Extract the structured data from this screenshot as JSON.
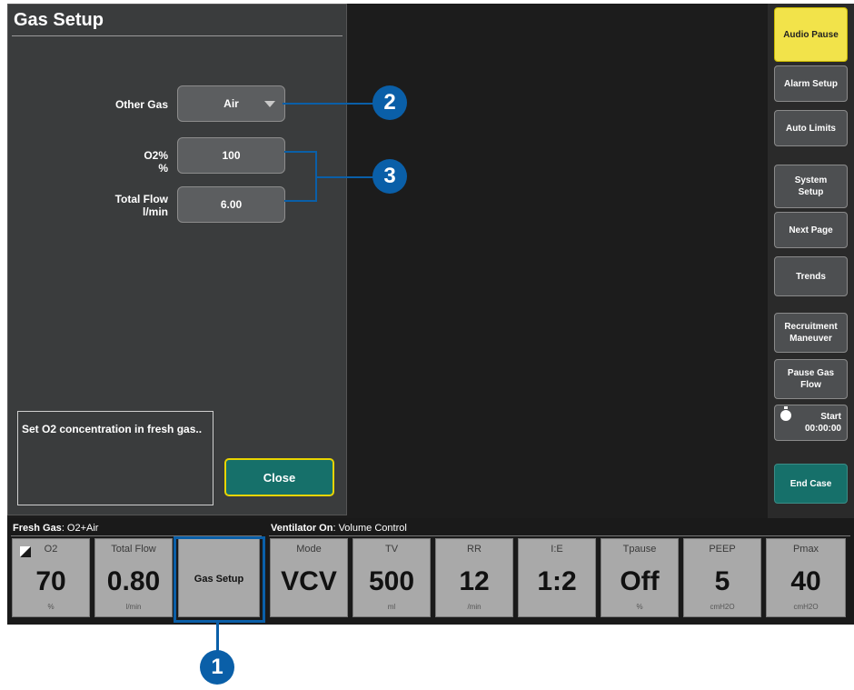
{
  "gas_setup": {
    "title": "Gas Setup",
    "other_gas_label": "Other Gas",
    "other_gas_value": "Air",
    "o2_label_line1": "O2%",
    "o2_label_line2": "%",
    "o2_value": "100",
    "total_flow_label_line1": "Total Flow",
    "total_flow_label_line2": "l/min",
    "total_flow_value": "6.00",
    "hint_text": "Set O2 concentration in fresh gas..",
    "close_label": "Close"
  },
  "side_buttons": [
    "Audio Pause",
    "Alarm Setup",
    "Auto Limits",
    "System Setup",
    "Next Page",
    "Trends",
    "Recruitment Maneuver",
    "Pause Gas Flow"
  ],
  "timer": {
    "label": "Start",
    "value": "00:00:00"
  },
  "end_case_label": "End Case",
  "fresh_gas": {
    "heading": "Fresh Gas",
    "mode": ": O2+Air",
    "o2": {
      "label": "O2",
      "value": "70",
      "unit": "%"
    },
    "total_flow": {
      "label": "Total Flow",
      "value": "0.80",
      "unit": "l/min"
    },
    "gas_setup_button": "Gas Setup"
  },
  "ventilator": {
    "heading": "Ventilator On",
    "mode_text": ": Volume Control",
    "tiles": [
      {
        "label": "Mode",
        "value": "VCV",
        "unit": ""
      },
      {
        "label": "TV",
        "value": "500",
        "unit": "ml"
      },
      {
        "label": "RR",
        "value": "12",
        "unit": "/min"
      },
      {
        "label": "I:E",
        "value": "1:2",
        "unit": ""
      },
      {
        "label": "Tpause",
        "value": "Off",
        "unit": "%"
      },
      {
        "label": "PEEP",
        "value": "5",
        "unit": "cmH2O"
      },
      {
        "label": "Pmax",
        "value": "40",
        "unit": "cmH2O"
      }
    ]
  },
  "callouts": [
    "1",
    "2",
    "3"
  ],
  "colors": {
    "callout": "#0a5fa8",
    "audio_pause": "#f2e34a",
    "end_case": "#16706a"
  }
}
